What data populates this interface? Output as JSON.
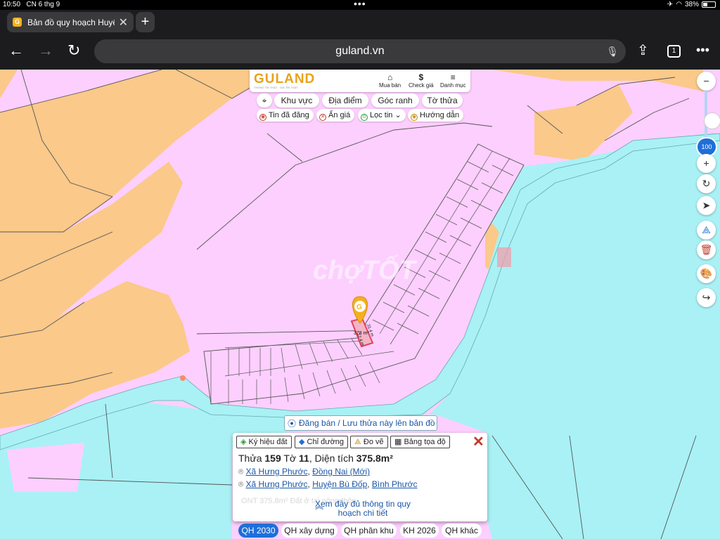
{
  "status": {
    "time": "10:50",
    "date": "CN 6 thg 9",
    "battery": "38%"
  },
  "browser": {
    "tab_title": "Bản đồ quy hoạch Huyện Bù Đốp",
    "url": "guland.vn",
    "tab_count": "1"
  },
  "guland": {
    "logo": "GULAND",
    "tagline": "THÔNG TIN THẬT · GIÁ TRỊ THẬT",
    "buy_label": "Mua bán",
    "price_label": "Check giá",
    "menu_label": "Danh mục"
  },
  "chips": {
    "area": "Khu vực",
    "place": "Địa điểm",
    "corner": "Góc ranh",
    "sheet": "Tờ thửa"
  },
  "filters": {
    "posted": "Tin đã đăng",
    "hide_price": "Ẩn giá",
    "filter": "Lọc tin",
    "guide": "Hướng dẫn"
  },
  "zoom": {
    "level": "100"
  },
  "map": {
    "watermark": "chợTỐT",
    "plot_area_label": "378 m²",
    "dim_label_1": "31.4 m",
    "dim_label_2": "12.4 m"
  },
  "post_button": "Đăng bán / Lưu thửa này lên bản đồ",
  "popup": {
    "tag_symbol": "Ký hiệu đất",
    "tag_route": "Chỉ đường",
    "tag_measure": "Đo vẽ",
    "tag_coords": "Bảng tọa độ",
    "title_prefix": "Thửa",
    "plot_no": "159",
    "sheet_prefix": "Tờ",
    "sheet_no": "11",
    "area_prefix": ", Diện tích",
    "area": "375.8m²",
    "addr1_commune": "Xã Hưng Phước",
    "addr1_province": "Đồng Nai (Mới)",
    "addr2_commune": "Xã Hưng Phước",
    "addr2_district": "Huyện Bù Đốp",
    "addr2_province": "Bình Phước",
    "faded_text": "ONT      375.8m²   Đất ở tại nông thôn",
    "more_label": "Xem đầy đủ thông tin quy hoạch chi tiết"
  },
  "layers": [
    "QH 2030",
    "QH xây dựng",
    "QH phân khu",
    "KH 2026",
    "QH khác"
  ],
  "colors": {
    "water": "#a9f1f5",
    "residential": "#fdcfff",
    "farmland": "#fbc98a",
    "accent": "#1e6fd9",
    "brand": "#e8a21b"
  }
}
